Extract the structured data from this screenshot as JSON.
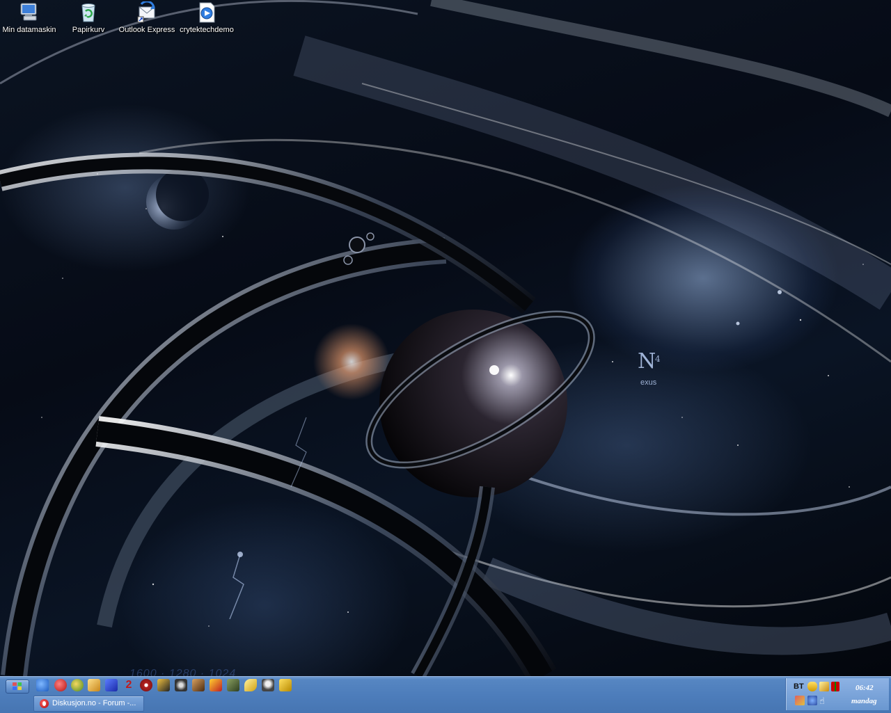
{
  "desktop": {
    "icons": [
      {
        "label": "Min datamaskin",
        "icon": "computer-icon"
      },
      {
        "label": "Papirkurv",
        "icon": "recycle-bin-icon"
      },
      {
        "label": "Outlook Express",
        "icon": "outlook-express-icon"
      },
      {
        "label": "crytektechdemo",
        "icon": "media-file-icon"
      }
    ],
    "wallpaper": {
      "logo_letter": "N",
      "logo_sup": "4",
      "logo_sub": "exus",
      "faint_text": "1600 · 1280 · 1024"
    }
  },
  "taskbar": {
    "quick_launch": [
      {
        "icon": "internet-explorer-icon",
        "color": "#2a6fd6"
      },
      {
        "icon": "opera-icon",
        "color": "#cc1b1b"
      },
      {
        "icon": "game-icon-1",
        "color": "#d7a21c"
      },
      {
        "icon": "pencil-icon",
        "color": "#e0a830"
      },
      {
        "icon": "bolt-icon",
        "color": "#2b4ccf"
      },
      {
        "icon": "number-two-icon",
        "color": "#c21a1a"
      },
      {
        "icon": "counter-strike-icon",
        "color": "#b52020"
      },
      {
        "icon": "star-game-icon",
        "color": "#222222"
      },
      {
        "icon": "skull-game-icon",
        "color": "#3a3a3a"
      },
      {
        "icon": "warrior-game-icon",
        "color": "#8a5a2c"
      },
      {
        "icon": "crest-game-icon",
        "color": "#c8a018"
      },
      {
        "icon": "map-game-icon",
        "color": "#4e6b3a"
      },
      {
        "icon": "key-icon",
        "color": "#e3c227"
      },
      {
        "icon": "ghost-icon",
        "color": "#555555"
      },
      {
        "icon": "folder-arrow-icon",
        "color": "#e8c020"
      }
    ],
    "task_buttons": [
      {
        "label": "Diskusjon.no - Forum -...",
        "icon": "opera-icon"
      }
    ],
    "tray": {
      "bt_label": "BT",
      "time": "06:42",
      "day": "mandag"
    }
  }
}
